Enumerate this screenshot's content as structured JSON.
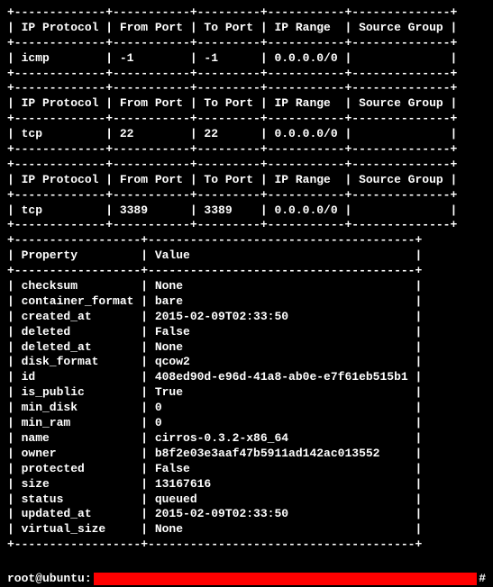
{
  "rules_header": {
    "c1": "IP Protocol",
    "c2": "From Port",
    "c3": "To Port",
    "c4": "IP Range",
    "c5": "Source Group"
  },
  "rules": [
    {
      "protocol": "icmp",
      "from_port": "-1",
      "to_port": "-1",
      "ip_range": "0.0.0.0/0",
      "source_group": ""
    },
    {
      "protocol": "tcp",
      "from_port": "22",
      "to_port": "22",
      "ip_range": "0.0.0.0/0",
      "source_group": ""
    },
    {
      "protocol": "tcp",
      "from_port": "3389",
      "to_port": "3389",
      "ip_range": "0.0.0.0/0",
      "source_group": ""
    }
  ],
  "props_header": {
    "c1": "Property",
    "c2": "Value"
  },
  "properties": [
    {
      "k": "checksum",
      "v": "None"
    },
    {
      "k": "container_format",
      "v": "bare"
    },
    {
      "k": "created_at",
      "v": "2015-02-09T02:33:50"
    },
    {
      "k": "deleted",
      "v": "False"
    },
    {
      "k": "deleted_at",
      "v": "None"
    },
    {
      "k": "disk_format",
      "v": "qcow2"
    },
    {
      "k": "id",
      "v": "408ed90d-e96d-41a8-ab0e-e7f61eb515b1"
    },
    {
      "k": "is_public",
      "v": "True"
    },
    {
      "k": "min_disk",
      "v": "0"
    },
    {
      "k": "min_ram",
      "v": "0"
    },
    {
      "k": "name",
      "v": "cirros-0.3.2-x86_64"
    },
    {
      "k": "owner",
      "v": "b8f2e03e3aaf47b5911ad142ac013552"
    },
    {
      "k": "protected",
      "v": "False"
    },
    {
      "k": "size",
      "v": "13167616"
    },
    {
      "k": "status",
      "v": "queued"
    },
    {
      "k": "updated_at",
      "v": "2015-02-09T02:33:50"
    },
    {
      "k": "virtual_size",
      "v": "None"
    }
  ],
  "prompt": {
    "user_host": "root@ubuntu",
    "colon": ":",
    "hash": "#"
  }
}
